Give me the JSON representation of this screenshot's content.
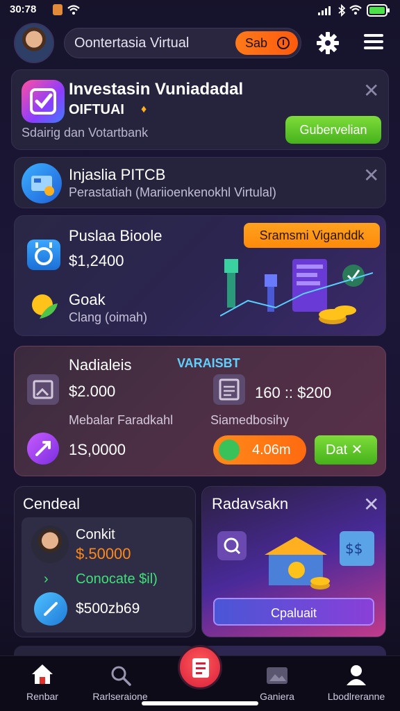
{
  "status_bar": {
    "time": "30:78"
  },
  "header": {
    "search_text": "Oontertasia Virtual",
    "save_label": "Sab"
  },
  "card_invest": {
    "title": "Investasin Vuniadadal",
    "subtitle": "OIFTUAI",
    "description": "Sdairig dan Votartbank",
    "button": "Gubervelian"
  },
  "card_info": {
    "title": "Injaslia PITCB",
    "subtitle": "Perastatiah (Mariioenkenokhl Virtulal)"
  },
  "card_balance": {
    "title": "Puslaa Bioole",
    "value": "$1,2400",
    "tag": "Sramsmi Viganddk",
    "label2": "Goak",
    "sub2": "Clang (oimah)"
  },
  "card_stats": {
    "title": "Nadialeis",
    "brand": "VARAISBT",
    "value1": "$2.000",
    "label1": "Mebalar Faradkahl",
    "value2": "160 :: $200",
    "label2": "Siamedbosihy",
    "value3": "1S,0000",
    "button1": "4.06m",
    "button2": "Dat ✕"
  },
  "card_general": {
    "heading": "Cendeal",
    "name": "Conkit",
    "amount": "$.50000",
    "link": "Conocate $il)",
    "value": "$500zb69"
  },
  "card_promo": {
    "heading": "Radavsakn",
    "button": "Cpaluait"
  },
  "bottom_nav": {
    "items": [
      {
        "label": "Renbar"
      },
      {
        "label": "Rarlseraione"
      },
      {
        "label": "Ganiera"
      },
      {
        "label": "Lbodlreranne"
      }
    ]
  },
  "colors": {
    "accent_orange": "#ff7a1a",
    "accent_green": "#46b21c",
    "background": "#16132b"
  }
}
